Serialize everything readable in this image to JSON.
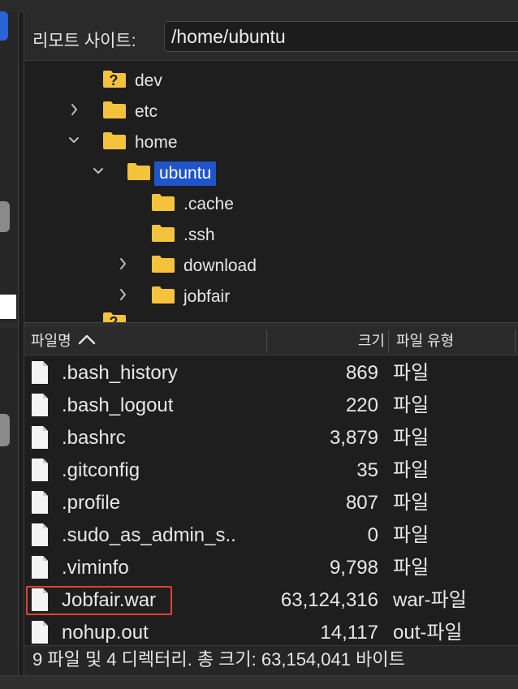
{
  "remote": {
    "label": "리모트 사이트:",
    "path": "/home/ubuntu"
  },
  "tree": [
    {
      "name": "dev",
      "icon": "folder-unknown-icon"
    },
    {
      "name": "etc",
      "icon": "folder-icon",
      "expand": "collapsed"
    },
    {
      "name": "home",
      "icon": "folder-icon",
      "expand": "expanded"
    },
    {
      "name": "ubuntu",
      "icon": "folder-icon",
      "expand": "expanded",
      "selected": true
    },
    {
      "name": ".cache",
      "icon": "folder-icon"
    },
    {
      "name": ".ssh",
      "icon": "folder-icon"
    },
    {
      "name": "download",
      "icon": "folder-icon",
      "expand": "collapsed"
    },
    {
      "name": "jobfair",
      "icon": "folder-icon",
      "expand": "collapsed"
    },
    {
      "name": "...",
      "icon": "folder-unknown-icon"
    }
  ],
  "columns": {
    "name": "파일명",
    "size": "크기",
    "type": "파일 유형"
  },
  "files": [
    {
      "name": ".bash_history",
      "size": "869",
      "type": "파일"
    },
    {
      "name": ".bash_logout",
      "size": "220",
      "type": "파일"
    },
    {
      "name": ".bashrc",
      "size": "3,879",
      "type": "파일"
    },
    {
      "name": ".gitconfig",
      "size": "35",
      "type": "파일"
    },
    {
      "name": ".profile",
      "size": "807",
      "type": "파일"
    },
    {
      "name": ".sudo_as_admin_s..",
      "size": "0",
      "type": "파일"
    },
    {
      "name": ".viminfo",
      "size": "9,798",
      "type": "파일"
    },
    {
      "name": "Jobfair.war",
      "size": "63,124,316",
      "type": "war-파일",
      "highlighted": true
    },
    {
      "name": "nohup.out",
      "size": "14,117",
      "type": "out-파일"
    }
  ],
  "status": "9 파일 및 4 디렉터리. 총 크기: 63,154,041 바이트",
  "colors": {
    "selection": "#1f55c8",
    "folder": "#f5c33b",
    "highlight_border": "#e0442e"
  }
}
